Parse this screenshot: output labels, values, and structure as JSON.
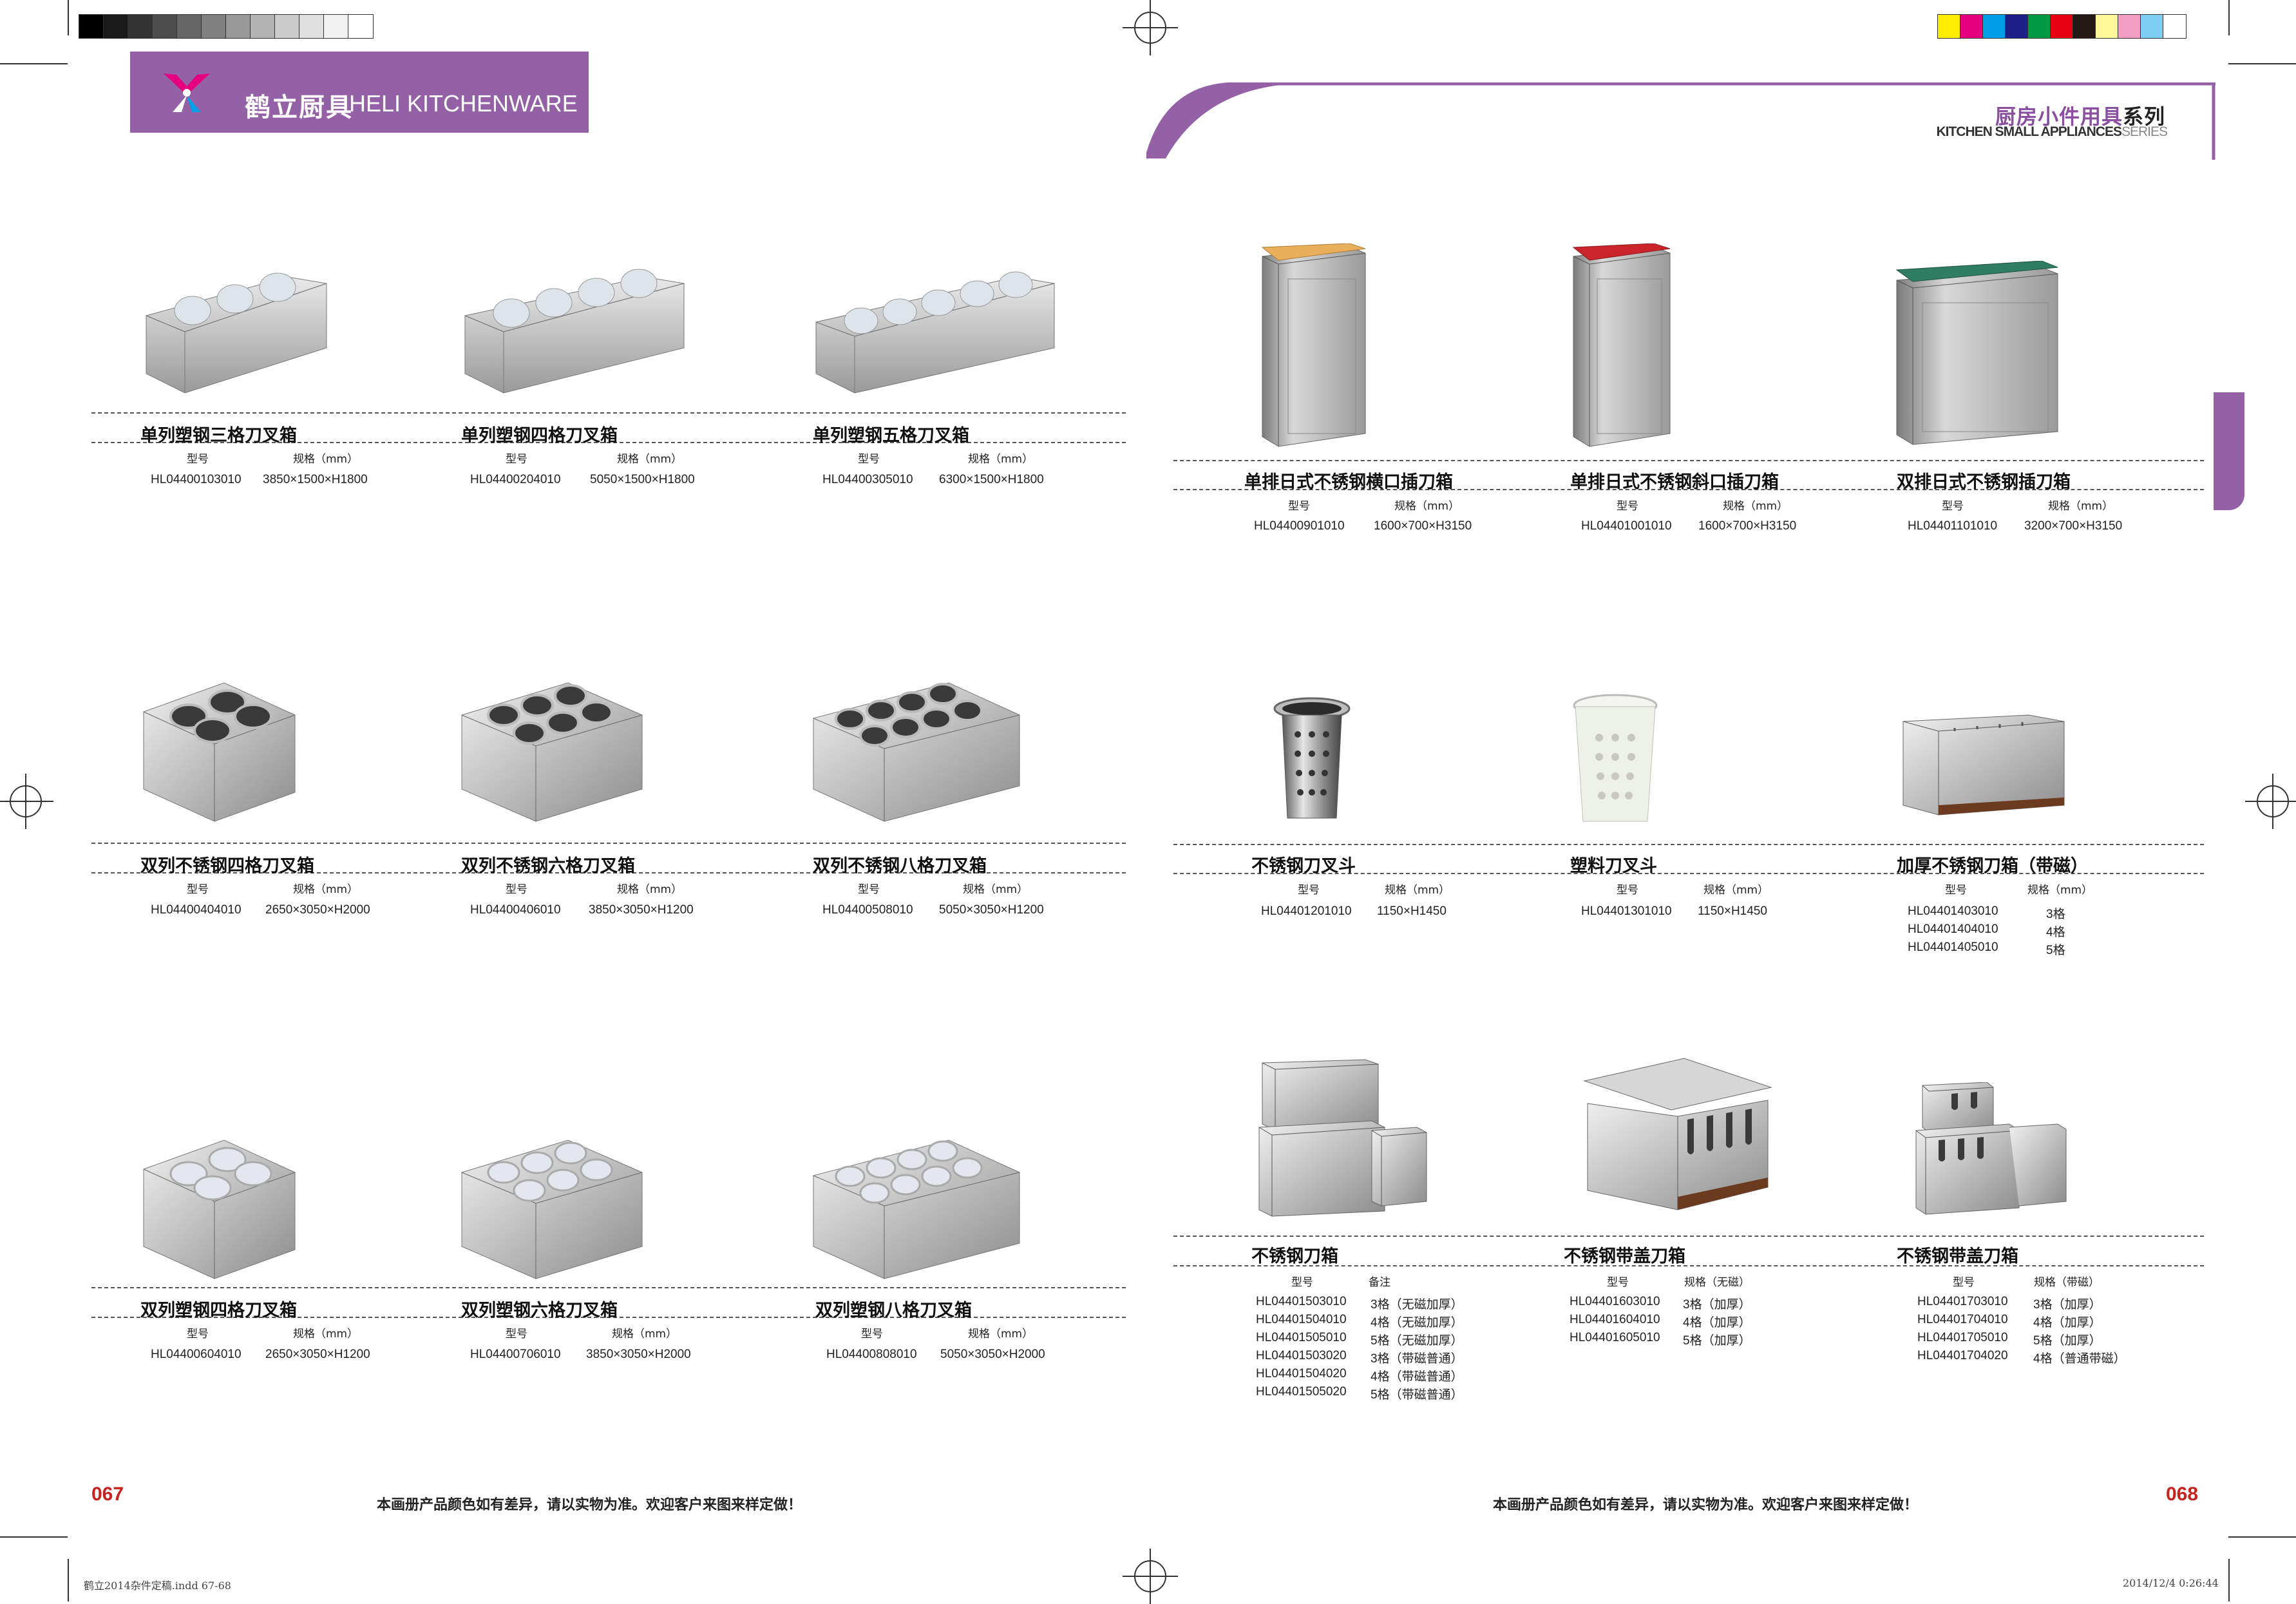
{
  "header": {
    "brand_cn": "鹤立厨具",
    "brand_en": "HELI KITCHENWARE",
    "series_cn_main": "厨房小件用具",
    "series_cn_tail": "系列",
    "series_en_main": "KITCHEN SMALL APPLIANCES",
    "series_en_tail": "SERIES"
  },
  "colors": {
    "brand_purple": "#9460a6",
    "page_number_red": "#c6221e"
  },
  "footer": {
    "note_left": "本画册产品颜色如有差异，请以实物为准。欢迎客户来图来样定做！",
    "note_right": "本画册产品颜色如有差异，请以实物为准。欢迎客户来图来样定做！",
    "page_left": "067",
    "page_right": "068",
    "slug_left": "鹤立2014杂件定稿.indd  67-68",
    "slug_right": "2014/12/4   0:26:44"
  },
  "left_products": [
    {
      "name": "单列塑钢三格刀叉箱",
      "h1": "型号",
      "h2": "规格（mm）",
      "rows": [
        [
          "HL04400103010",
          "3850×1500×H1800"
        ]
      ],
      "icon": "cutlery-holder-plastic-3-row"
    },
    {
      "name": "单列塑钢四格刀叉箱",
      "h1": "型号",
      "h2": "规格（mm）",
      "rows": [
        [
          "HL04400204010",
          "5050×1500×H1800"
        ]
      ],
      "icon": "cutlery-holder-plastic-4-row"
    },
    {
      "name": "单列塑钢五格刀叉箱",
      "h1": "型号",
      "h2": "规格（mm）",
      "rows": [
        [
          "HL04400305010",
          "6300×1500×H1800"
        ]
      ],
      "icon": "cutlery-holder-plastic-5-row"
    },
    {
      "name": "双列不锈钢四格刀叉箱",
      "h1": "型号",
      "h2": "规格（mm）",
      "rows": [
        [
          "HL04400404010",
          "2650×3050×H2000"
        ]
      ],
      "icon": "cutlery-holder-steel-4-grid"
    },
    {
      "name": "双列不锈钢六格刀叉箱",
      "h1": "型号",
      "h2": "规格（mm）",
      "rows": [
        [
          "HL04400406010",
          "3850×3050×H1200"
        ]
      ],
      "icon": "cutlery-holder-steel-6-grid"
    },
    {
      "name": "双列不锈钢八格刀叉箱",
      "h1": "型号",
      "h2": "规格（mm）",
      "rows": [
        [
          "HL04400508010",
          "5050×3050×H1200"
        ]
      ],
      "icon": "cutlery-holder-steel-8-grid"
    },
    {
      "name": "双列塑钢四格刀叉箱",
      "h1": "型号",
      "h2": "规格（mm）",
      "rows": [
        [
          "HL04400604010",
          "2650×3050×H1200"
        ]
      ],
      "icon": "cutlery-holder-plastic-4-grid"
    },
    {
      "name": "双列塑钢六格刀叉箱",
      "h1": "型号",
      "h2": "规格（mm）",
      "rows": [
        [
          "HL04400706010",
          "3850×3050×H2000"
        ]
      ],
      "icon": "cutlery-holder-plastic-6-grid"
    },
    {
      "name": "双列塑钢八格刀叉箱",
      "h1": "型号",
      "h2": "规格（mm）",
      "rows": [
        [
          "HL04400808010",
          "5050×3050×H2000"
        ]
      ],
      "icon": "cutlery-holder-plastic-8-grid"
    }
  ],
  "right_products": [
    {
      "name": "单排日式不锈钢横口插刀箱",
      "h1": "型号",
      "h2": "规格（mm）",
      "rows": [
        [
          "HL04400901010",
          "1600×700×H3150"
        ]
      ],
      "icon": "knife-block-wood-top"
    },
    {
      "name": "单排日式不锈钢斜口插刀箱",
      "h1": "型号",
      "h2": "规格（mm）",
      "rows": [
        [
          "HL04401001010",
          "1600×700×H3150"
        ]
      ],
      "icon": "knife-block-red-top"
    },
    {
      "name": "双排日式不锈钢插刀箱",
      "h1": "型号",
      "h2": "规格（mm）",
      "rows": [
        [
          "HL04401101010",
          "3200×700×H3150"
        ]
      ],
      "icon": "knife-block-green-top"
    },
    {
      "name": "不锈钢刀叉斗",
      "h1": "型号",
      "h2": "规格（mm）",
      "rows": [
        [
          "HL04401201010",
          "1150×H1450"
        ]
      ],
      "icon": "cutlery-cylinder-steel"
    },
    {
      "name": "塑料刀叉斗",
      "h1": "型号",
      "h2": "规格（mm）",
      "rows": [
        [
          "HL04401301010",
          "1150×H1450"
        ]
      ],
      "icon": "cutlery-cylinder-plastic"
    },
    {
      "name": "加厚不锈钢刀箱（带磁）",
      "h1": "型号",
      "h2": "规格（mm）",
      "rows": [
        [
          "HL04401403010",
          "3格"
        ],
        [
          "HL04401404010",
          "4格"
        ],
        [
          "HL04401405010",
          "5格"
        ]
      ],
      "icon": "knife-box-magnetic"
    },
    {
      "name": "不锈钢刀箱",
      "h1": "型号",
      "h2": "备注",
      "rows": [
        [
          "HL04401503010",
          "3格（无磁加厚）"
        ],
        [
          "HL04401504010",
          "4格（无磁加厚）"
        ],
        [
          "HL04401505010",
          "5格（无磁加厚）"
        ],
        [
          "HL04401503020",
          "3格（带磁普通）"
        ],
        [
          "HL04401504020",
          "4格（带磁普通）"
        ],
        [
          "HL04401505020",
          "5格（带磁普通）"
        ]
      ],
      "icon": "knife-box-steel"
    },
    {
      "name": "不锈钢带盖刀箱",
      "h1": "型号",
      "h2": "规格（无磁）",
      "rows": [
        [
          "HL04401603010",
          "3格（加厚）"
        ],
        [
          "HL04401604010",
          "4格（加厚）"
        ],
        [
          "HL04401605010",
          "5格（加厚）"
        ]
      ],
      "icon": "knife-box-lidded"
    },
    {
      "name": "不锈钢带盖刀箱",
      "h1": "型号",
      "h2": "规格（带磁）",
      "rows": [
        [
          "HL04401703010",
          "3格（加厚）"
        ],
        [
          "HL04401704010",
          "4格（加厚）"
        ],
        [
          "HL04401705010",
          "5格（加厚）"
        ],
        [
          "HL04401704020",
          "4格（普通带磁）"
        ]
      ],
      "icon": "knife-box-lidded-magnetic"
    }
  ]
}
